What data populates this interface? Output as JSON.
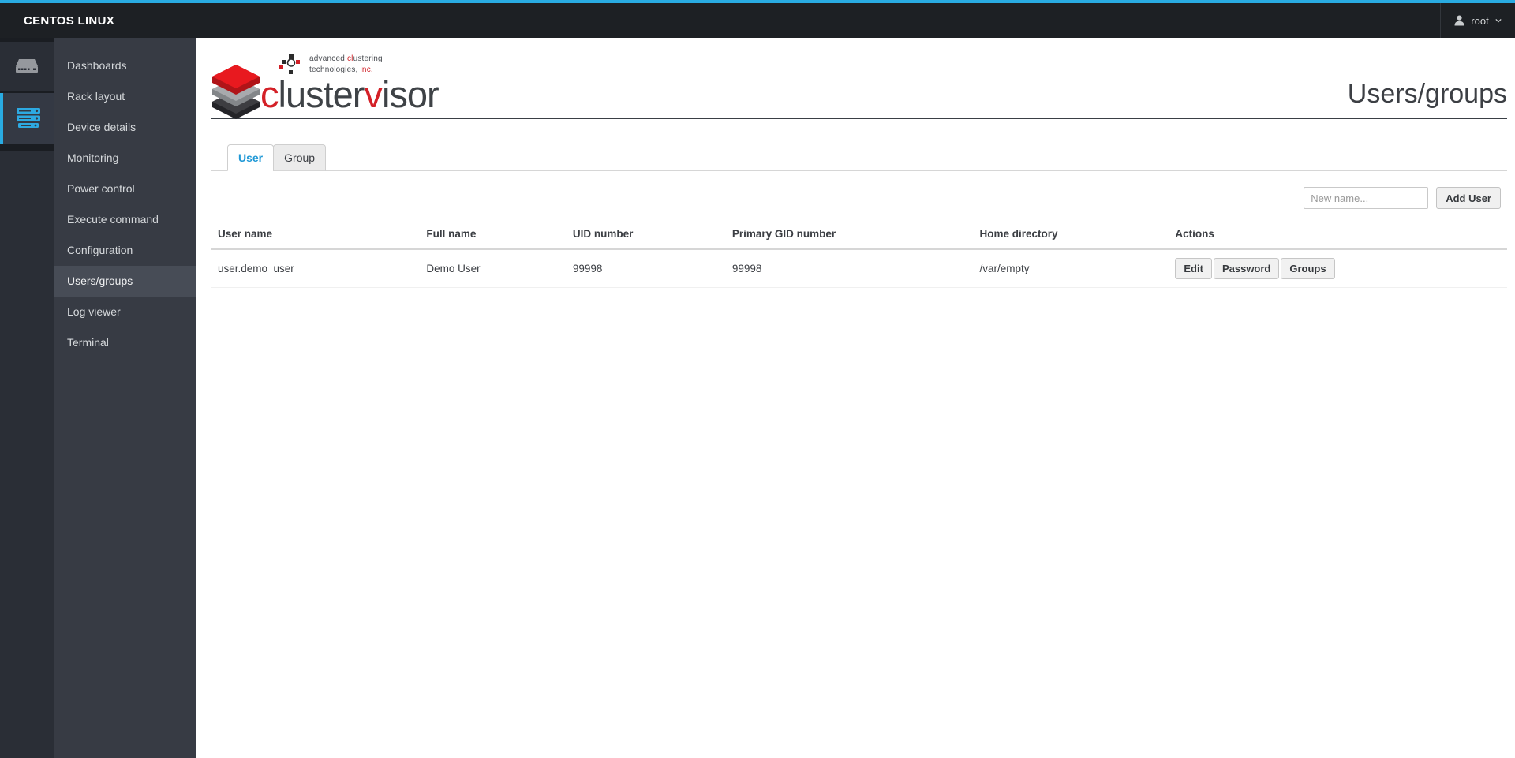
{
  "topbar": {
    "brand": "CENTOS LINUX",
    "user": "root"
  },
  "sidebar": {
    "rail_icons": [
      {
        "name": "server-rack-icon",
        "active": false
      },
      {
        "name": "server-stack-icon",
        "active": true
      }
    ],
    "items": [
      {
        "label": "Dashboards",
        "active": false
      },
      {
        "label": "Rack layout",
        "active": false
      },
      {
        "label": "Device details",
        "active": false
      },
      {
        "label": "Monitoring",
        "active": false
      },
      {
        "label": "Power control",
        "active": false
      },
      {
        "label": "Execute command",
        "active": false
      },
      {
        "label": "Configuration",
        "active": false
      },
      {
        "label": "Users/groups",
        "active": true
      },
      {
        "label": "Log viewer",
        "active": false
      },
      {
        "label": "Terminal",
        "active": false
      }
    ]
  },
  "logo": {
    "word": {
      "p1": "c",
      "p2": "luster",
      "p3": "v",
      "p4": "isor"
    },
    "tagline": {
      "l1a": "advanced ",
      "l1b": "cl",
      "l1c": "ustering",
      "l2a": "technologies, ",
      "l2b": "inc."
    }
  },
  "page": {
    "title": "Users/groups"
  },
  "tabs": [
    {
      "label": "User",
      "active": true
    },
    {
      "label": "Group",
      "active": false
    }
  ],
  "controls": {
    "placeholder": "New name...",
    "add_button": "Add User"
  },
  "table": {
    "headers": [
      "User name",
      "Full name",
      "UID number",
      "Primary GID number",
      "Home directory",
      "Actions"
    ],
    "rows": [
      {
        "user_name": "user.demo_user",
        "full_name": "Demo User",
        "uid": "99998",
        "gid": "99998",
        "home": "/var/empty",
        "actions": [
          "Edit",
          "Password",
          "Groups"
        ]
      }
    ]
  },
  "colors": {
    "accent_blue": "#29abe2",
    "brand_red": "#d42027",
    "active_tab_text": "#1f98d6",
    "topbar_bg": "#1d2024",
    "sidebar_menu_bg": "#373b44",
    "sidebar_active_bg": "#474c56"
  }
}
